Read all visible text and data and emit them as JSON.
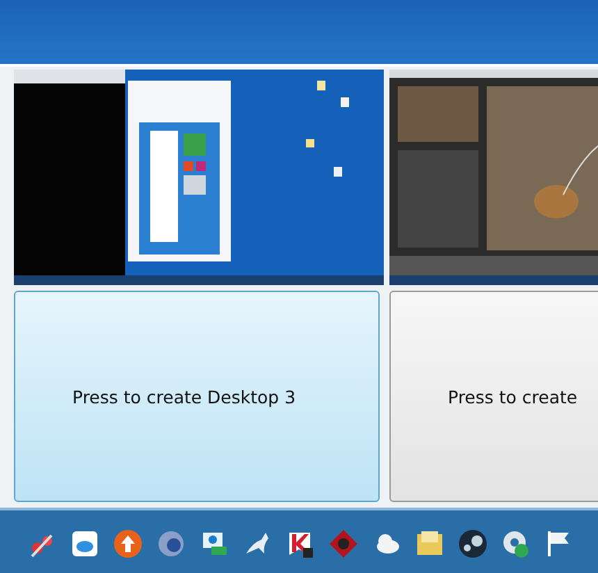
{
  "desktops": [
    {
      "preview": {
        "kind": "desktop"
      },
      "button": {
        "label": "Press to create Desktop 3",
        "selected": true
      }
    },
    {
      "preview": {
        "kind": "photo-editor"
      },
      "button": {
        "label": "Press to create",
        "selected": false
      }
    }
  ]
}
